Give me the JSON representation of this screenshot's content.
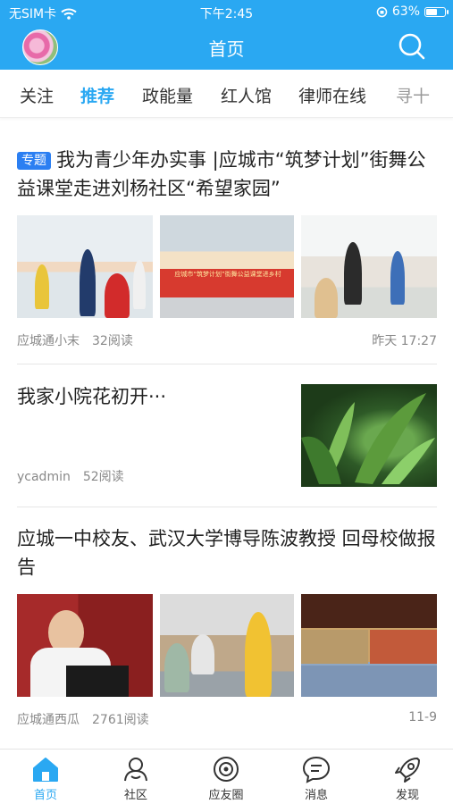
{
  "statusbar": {
    "carrier": "无SIM卡",
    "time": "下午2:45",
    "battery": "63%",
    "battery_level": 0.63
  },
  "header": {
    "title": "首页"
  },
  "tabs": [
    {
      "label": "关注"
    },
    {
      "label": "推荐"
    },
    {
      "label": "政能量"
    },
    {
      "label": "红人馆"
    },
    {
      "label": "律师在线"
    },
    {
      "label": "寻十"
    }
  ],
  "articles": [
    {
      "tag": "专题",
      "title": "我为青少年办实事 |应城市“筑梦计划”街舞公益课堂走进刘杨社区“希望家园”",
      "author": "应城通小末",
      "reads": "32阅读",
      "time": "昨天 17:27",
      "banner_text": "应城市“筑梦计划”街舞公益课堂进乡村"
    },
    {
      "title": "我家小院花初开···",
      "author": "ycadmin",
      "reads": "52阅读"
    },
    {
      "title": "应城一中校友、武汉大学博导陈波教授 回母校做报告",
      "author": "应城通西瓜",
      "reads": "2761阅读",
      "time": "11-9"
    }
  ],
  "bottom_nav": [
    {
      "label": "首页",
      "icon": "home-icon"
    },
    {
      "label": "社区",
      "icon": "community-icon"
    },
    {
      "label": "应友圈",
      "icon": "friends-circle-icon"
    },
    {
      "label": "消息",
      "icon": "message-icon"
    },
    {
      "label": "发现",
      "icon": "rocket-icon"
    }
  ],
  "colors": {
    "accent": "#2aa8f2",
    "tag": "#2b7ff2"
  }
}
